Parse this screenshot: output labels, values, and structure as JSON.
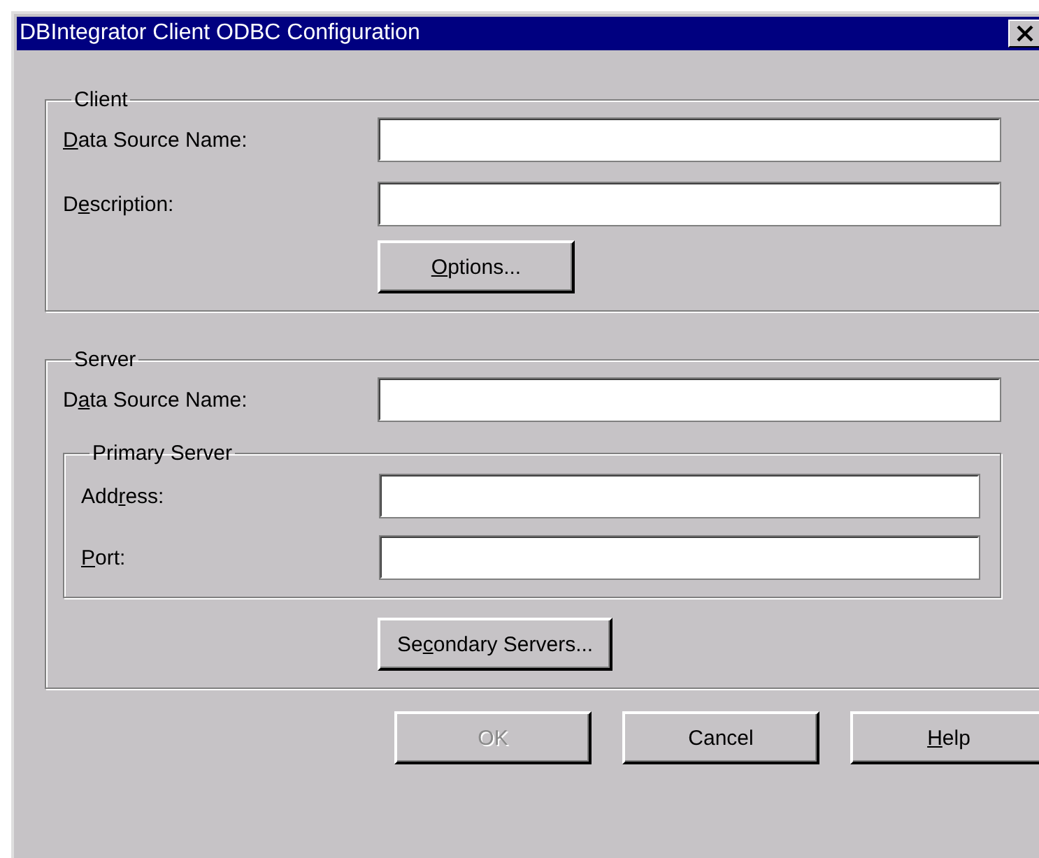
{
  "window": {
    "title": "DBIntegrator Client ODBC Configuration"
  },
  "client": {
    "legend": "Client",
    "fields": [
      {
        "mnemonic": "D",
        "label_rest": "ata Source Name:"
      },
      {
        "label_start": "D",
        "mnemonic": "e",
        "label_rest": "scription:"
      }
    ],
    "button": {
      "mnemonic": "O",
      "label_rest": "ptions...",
      "disabled": false
    }
  },
  "server": {
    "legend": "Server",
    "fields": [
      {
        "label_start": "D",
        "mnemonic": "a",
        "label_rest": "ta Source Name:"
      }
    ],
    "primary": {
      "legend": "Primary Server",
      "fields": [
        {
          "label_start": "Add",
          "mnemonic": "r",
          "label_rest": "ess:"
        },
        {
          "mnemonic": "P",
          "label_rest": "ort:"
        }
      ]
    },
    "button": {
      "label_start": "Se",
      "mnemonic": "c",
      "label_rest": "ondary Servers...",
      "disabled": false
    }
  },
  "buttons": [
    {
      "label_rest": "OK",
      "disabled": true
    },
    {
      "label_rest": "Cancel",
      "disabled": false
    },
    {
      "mnemonic": "H",
      "label_rest": "elp",
      "disabled": false
    }
  ]
}
